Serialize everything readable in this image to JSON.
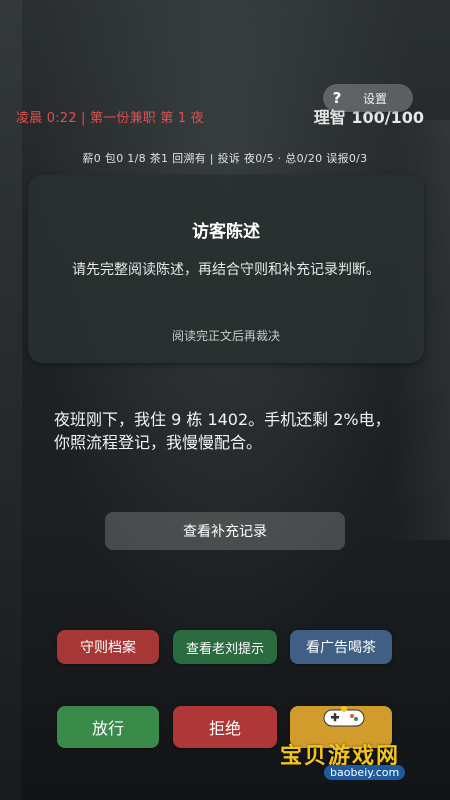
{
  "header": {
    "time_line": "凌晨 0:22 | 第一份兼职 第 1 夜",
    "sanity": "理智 100/100",
    "help_label": "?",
    "settings_label": "设置"
  },
  "stats": {
    "line": "薪0 包0 1/8 茶1 回溯有 | 投诉 夜0/5 · 总0/20 误报0/3"
  },
  "panel": {
    "title": "访客陈述",
    "description": "请先完整阅读陈述，再结合守则和补充记录判断。",
    "hint": "阅读完正文后再裁决"
  },
  "statement": {
    "text": "夜班刚下，我住 9 栋 1402。手机还剩 2%电，你照流程登记，我慢慢配合。"
  },
  "buttons": {
    "supplement": "查看补充记录",
    "rules": "守则档案",
    "hint": "查看老刘提示",
    "ad": "看广告喝茶",
    "pass": "放行",
    "reject": "拒绝"
  },
  "watermark": {
    "main": "宝贝游戏网",
    "url": "baobeiy.com"
  },
  "colors": {
    "alert_red": "#e24f4f",
    "danger": "#b03737",
    "success": "#3a8a4a",
    "info": "#3f5f85",
    "accent": "#d29c2c"
  }
}
